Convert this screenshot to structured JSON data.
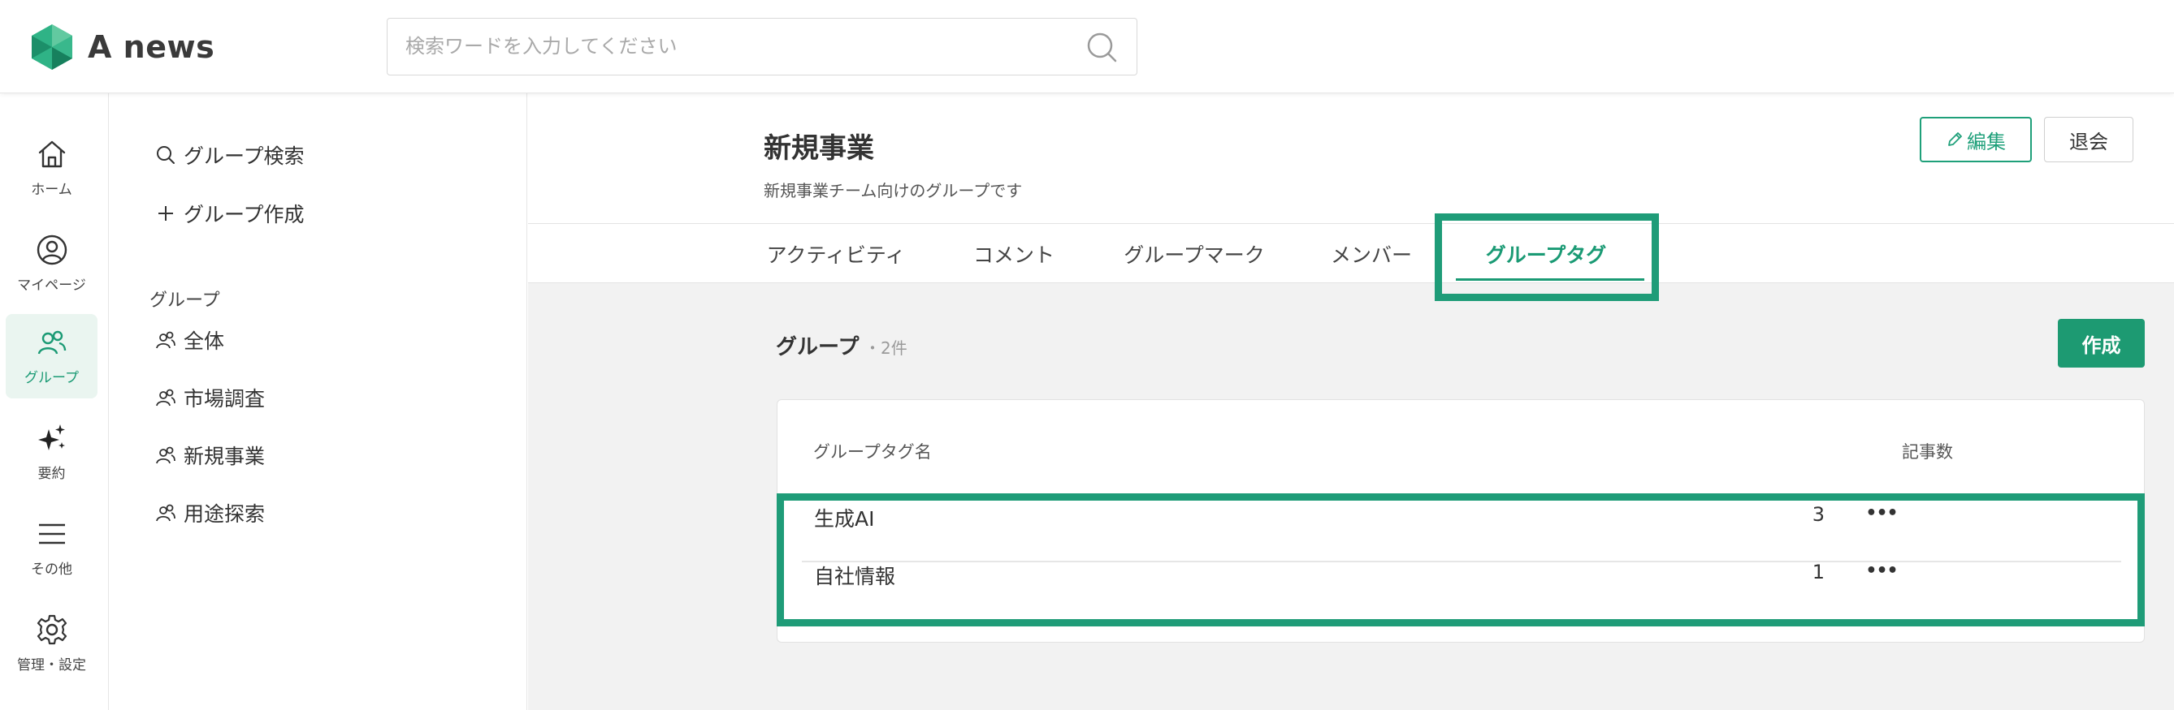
{
  "app": {
    "name": "A news"
  },
  "search": {
    "placeholder": "検索ワードを入力してください",
    "value": ""
  },
  "rail": {
    "items": [
      {
        "label": "ホーム",
        "icon": "home-icon"
      },
      {
        "label": "マイページ",
        "icon": "user-circle-icon"
      },
      {
        "label": "グループ",
        "icon": "group-icon",
        "active": true
      },
      {
        "label": "要約",
        "icon": "sparkle-icon"
      },
      {
        "label": "その他",
        "icon": "menu-icon"
      },
      {
        "label": "管理・設定",
        "icon": "gear-icon"
      }
    ]
  },
  "group_panel": {
    "search_label": "グループ検索",
    "create_label": "グループ作成",
    "section_label": "グループ",
    "groups": [
      "全体",
      "市場調査",
      "新規事業",
      "用途探索"
    ]
  },
  "main": {
    "title": "新規事業",
    "description": "新規事業チーム向けのグループです",
    "edit_label": "編集",
    "leave_label": "退会",
    "tabs": [
      "アクティビティ",
      "コメント",
      "グループマーク",
      "メンバー",
      "グループタグ"
    ],
    "active_tab": "グループタグ",
    "section_title": "グループ",
    "section_count": "・2件",
    "create_label": "作成",
    "table": {
      "columns": [
        "グループタグ名",
        "記事数"
      ],
      "rows": [
        {
          "name": "生成AI",
          "count": "3"
        },
        {
          "name": "自社情報",
          "count": "1"
        }
      ]
    }
  },
  "colors": {
    "accent": "#1a9a74",
    "highlight": "#1f9c78",
    "content_bg": "#f2f2f2"
  }
}
